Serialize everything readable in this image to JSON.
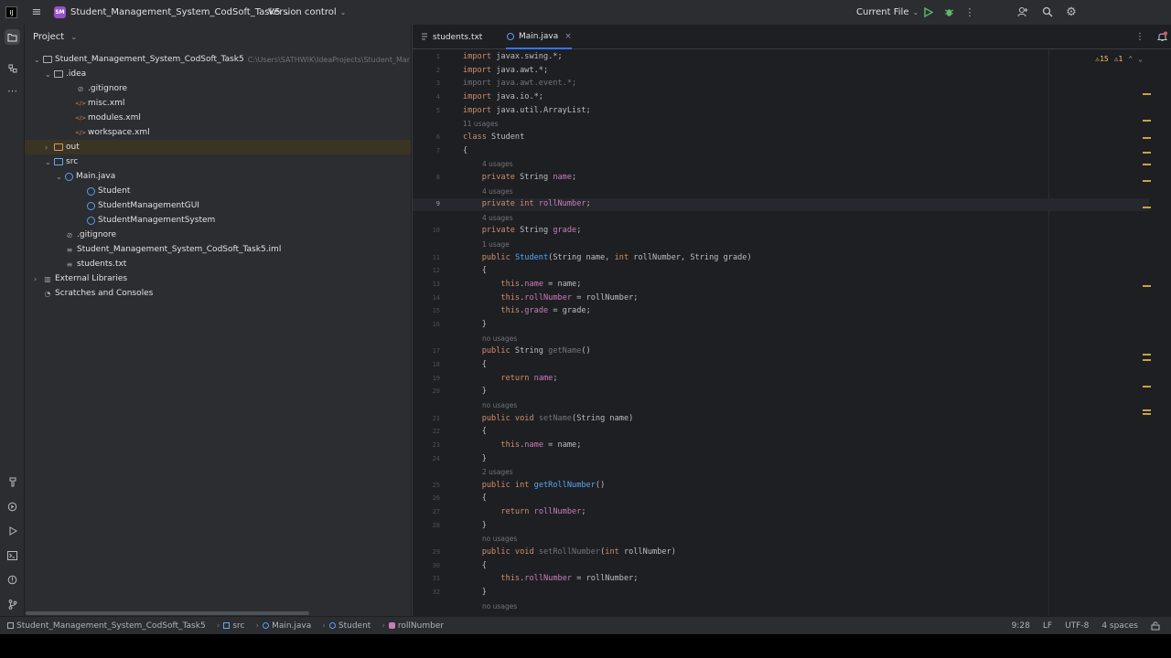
{
  "titlebar": {
    "project_badge": "SM",
    "project_name": "Student_Management_System_CodSoft_Task5",
    "vcs": "Version control",
    "run_config": "Current File"
  },
  "project_panel": {
    "title": "Project",
    "tree": [
      {
        "label": "Student_Management_System_CodSoft_Task5",
        "path": "C:\\Users\\SATHWIK\\IdeaProjects\\Student_Mar",
        "depth": 1,
        "arrow": "open",
        "icon": "folder"
      },
      {
        "label": ".idea",
        "depth": 2,
        "arrow": "open",
        "icon": "folder"
      },
      {
        "label": ".gitignore",
        "depth": 4,
        "arrow": "",
        "icon": "ignore"
      },
      {
        "label": "misc.xml",
        "depth": 4,
        "arrow": "",
        "icon": "xml"
      },
      {
        "label": "modules.xml",
        "depth": 4,
        "arrow": "",
        "icon": "xml"
      },
      {
        "label": "workspace.xml",
        "depth": 4,
        "arrow": "",
        "icon": "xml"
      },
      {
        "label": "out",
        "depth": 2,
        "arrow": "closed",
        "icon": "folder-out",
        "selected": true
      },
      {
        "label": "src",
        "depth": 2,
        "arrow": "open",
        "icon": "folder-src"
      },
      {
        "label": "Main.java",
        "depth": 3,
        "arrow": "open",
        "icon": "class"
      },
      {
        "label": "Student",
        "depth": 5,
        "arrow": "",
        "icon": "class"
      },
      {
        "label": "StudentManagementGUI",
        "depth": 5,
        "arrow": "",
        "icon": "class"
      },
      {
        "label": "StudentManagementSystem",
        "depth": 5,
        "arrow": "",
        "icon": "class"
      },
      {
        "label": ".gitignore",
        "depth": 3,
        "arrow": "",
        "icon": "ignore"
      },
      {
        "label": "Student_Management_System_CodSoft_Task5.iml",
        "depth": 3,
        "arrow": "",
        "icon": "file"
      },
      {
        "label": "students.txt",
        "depth": 3,
        "arrow": "",
        "icon": "file"
      },
      {
        "label": "External Libraries",
        "depth": 1,
        "arrow": "closed",
        "icon": "library"
      },
      {
        "label": "Scratches and Consoles",
        "depth": 1,
        "arrow": "",
        "icon": "scratch"
      }
    ]
  },
  "editor": {
    "tabs": [
      {
        "label": "students.txt",
        "active": false
      },
      {
        "label": "Main.java",
        "active": true
      }
    ],
    "warnings": "⚠15",
    "weak_warnings": "⚠1",
    "lines": [
      {
        "n": "1",
        "html": "<span class=\"kw\">import</span> javax.swing.*;"
      },
      {
        "n": "2",
        "html": "<span class=\"kw\">import</span> java.awt.*;"
      },
      {
        "n": "3",
        "html": "<span class=\"dim\">import java.awt.event.*;</span>"
      },
      {
        "n": "4",
        "html": "<span class=\"kw\">import</span> java.io.*;"
      },
      {
        "n": "5",
        "html": "<span class=\"kw\">import</span> java.util.ArrayList;"
      },
      {
        "hint": "11 usages",
        "indent": 0
      },
      {
        "n": "6",
        "html": "<span class=\"kw\">class</span> Student"
      },
      {
        "n": "7",
        "html": "{"
      },
      {
        "hint": "4 usages",
        "indent": 1
      },
      {
        "n": "8",
        "html": "    <span class=\"kw\">private</span> String <span class=\"fld\">name</span>;"
      },
      {
        "hint": "4 usages",
        "indent": 1
      },
      {
        "n": "9",
        "html": "    <span class=\"kw\">private int</span> <span class=\"fld\">rollNumber</span>;",
        "current": true
      },
      {
        "hint": "4 usages",
        "indent": 1
      },
      {
        "n": "10",
        "html": "    <span class=\"kw\">private</span> String <span class=\"fld\">grade</span>;"
      },
      {
        "hint": "1 usage",
        "indent": 1
      },
      {
        "n": "11",
        "html": "    <span class=\"kw\">public</span> <span class=\"mth\">Student</span>(String name, <span class=\"kw\">int</span> rollNumber, String grade)"
      },
      {
        "n": "12",
        "html": "    {"
      },
      {
        "n": "13",
        "html": "        <span class=\"kw\">this</span>.<span class=\"fld\">name</span> = name;"
      },
      {
        "n": "14",
        "html": "        <span class=\"kw\">this</span>.<span class=\"fld\">rollNumber</span> = rollNumber;"
      },
      {
        "n": "15",
        "html": "        <span class=\"kw\">this</span>.<span class=\"fld\">grade</span> = grade;"
      },
      {
        "n": "16",
        "html": "    }"
      },
      {
        "hint": "no usages",
        "indent": 1
      },
      {
        "n": "17",
        "html": "    <span class=\"kw\">public</span> String <span class=\"dim\">getName</span>()"
      },
      {
        "n": "18",
        "html": "    {"
      },
      {
        "n": "19",
        "html": "        <span class=\"kw\">return</span> <span class=\"fld\">name</span>;"
      },
      {
        "n": "20",
        "html": "    }"
      },
      {
        "hint": "no usages",
        "indent": 1
      },
      {
        "n": "21",
        "html": "    <span class=\"kw\">public void</span> <span class=\"dim\">setName</span>(String name)"
      },
      {
        "n": "22",
        "html": "    {"
      },
      {
        "n": "23",
        "html": "        <span class=\"kw\">this</span>.<span class=\"fld\">name</span> = name;"
      },
      {
        "n": "24",
        "html": "    }"
      },
      {
        "hint": "2 usages",
        "indent": 1
      },
      {
        "n": "25",
        "html": "    <span class=\"kw\">public int</span> <span class=\"mth\">getRollNumber</span>()"
      },
      {
        "n": "26",
        "html": "    {"
      },
      {
        "n": "27",
        "html": "        <span class=\"kw\">return</span> <span class=\"fld\">rollNumber</span>;"
      },
      {
        "n": "28",
        "html": "    }"
      },
      {
        "hint": "no usages",
        "indent": 1
      },
      {
        "n": "29",
        "html": "    <span class=\"kw\">public void</span> <span class=\"dim\">setRollNumber</span>(<span class=\"kw\">int</span> rollNumber)"
      },
      {
        "n": "30",
        "html": "    {"
      },
      {
        "n": "31",
        "html": "        <span class=\"kw\">this</span>.<span class=\"fld\">rollNumber</span> = rollNumber;"
      },
      {
        "n": "32",
        "html": "    }"
      },
      {
        "hint": "no usages",
        "indent": 1
      }
    ]
  },
  "statusbar": {
    "crumbs": [
      "Student_Management_System_CodSoft_Task5",
      "src",
      "Main.java",
      "Student",
      "rollNumber"
    ],
    "position": "9:28",
    "line_ending": "LF",
    "encoding": "UTF-8",
    "indent": "4 spaces"
  },
  "colors": {
    "accent": "#3574f0",
    "badge": "#9c4fc7",
    "warning": "#f2c55c"
  }
}
